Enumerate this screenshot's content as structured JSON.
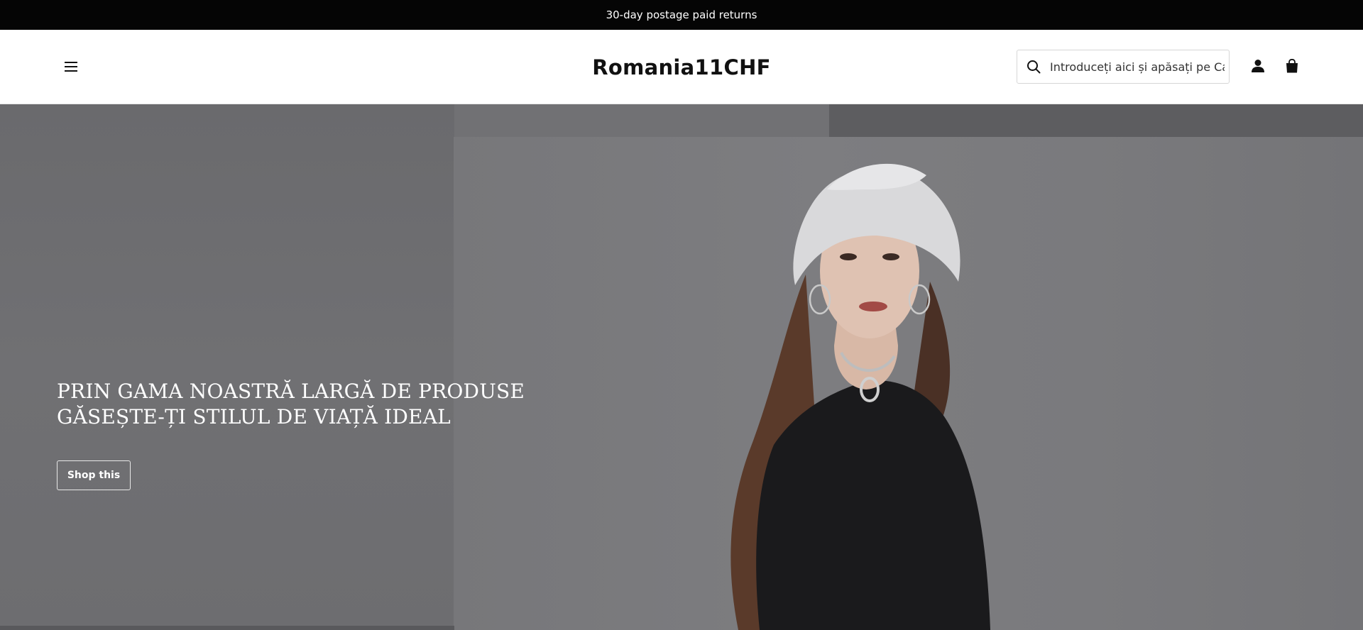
{
  "announcement": {
    "text": "30-day postage paid returns"
  },
  "header": {
    "logo": "Romania11CHF",
    "search": {
      "placeholder": "Introduceți aici și apăsați pe Ca"
    }
  },
  "hero": {
    "heading_lines": [
      "PRIN GAMA NOASTRĂ LARGĂ DE PRODUSE",
      "GĂSEȘTE-ȚI STILUL DE VIAȚĂ IDEAL"
    ],
    "button_label": "Shop this"
  },
  "icons": {
    "menu": "hamburger-menu-icon",
    "search": "search-icon",
    "account": "user-icon",
    "cart": "shopping-bag-icon"
  },
  "colors": {
    "announcement_bg": "#050505",
    "announcement_text": "#ffffff",
    "header_bg": "#ffffff",
    "hero_overlay": "#6b6b6e",
    "hero_text": "#ffffff"
  }
}
